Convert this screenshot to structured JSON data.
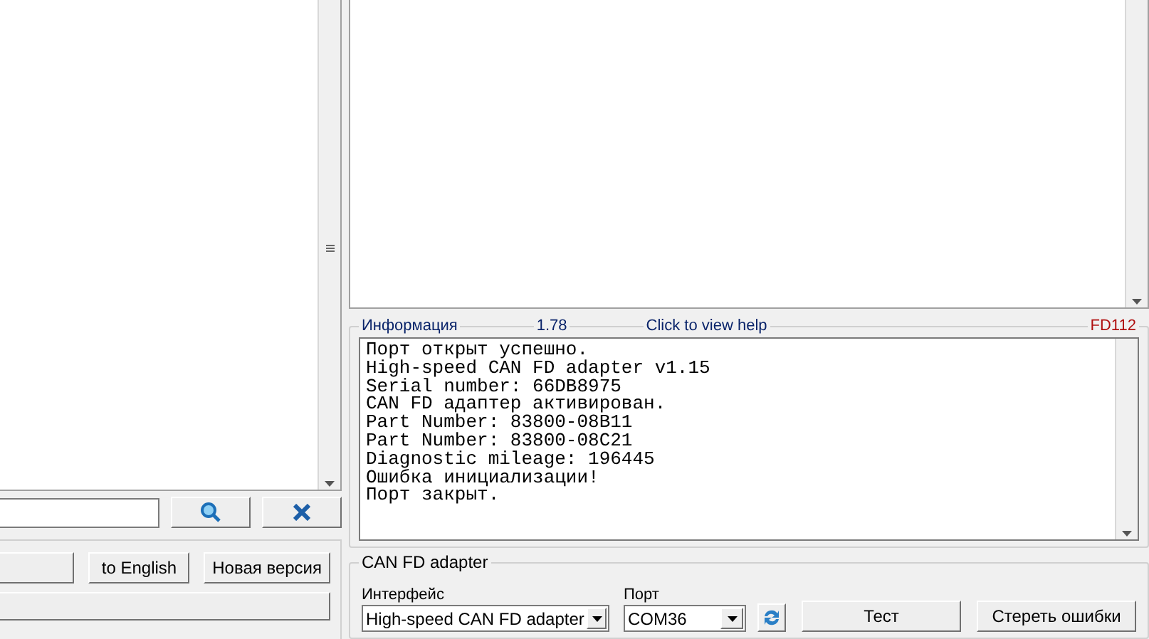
{
  "left_panel": {
    "buttons": [
      {
        "kind": "blank"
      },
      {
        "kind": "text",
        "label": "to English"
      },
      {
        "kind": "text",
        "label": "Новая версия"
      }
    ]
  },
  "info": {
    "title": "Информация",
    "version": "1.78",
    "help_link": "Click to view help",
    "code": "FD112",
    "log": [
      "Порт открыт успешно.",
      "High-speed CAN FD adapter v1.15",
      "Serial number: 66DB8975",
      "CAN FD адаптер активирован.",
      "Part Number: 83800-08B11",
      "Part Number: 83800-08C21",
      "Diagnostic mileage: 196445",
      "Ошибка инициализации!",
      "Порт закрыт."
    ]
  },
  "adapter": {
    "title": "CAN FD adapter",
    "interface_label": "Интерфейс",
    "interface_value": "High-speed CAN FD adapter",
    "port_label": "Порт",
    "port_value": "COM36",
    "buttons": [
      "Тест",
      "Стереть ошибки"
    ]
  }
}
